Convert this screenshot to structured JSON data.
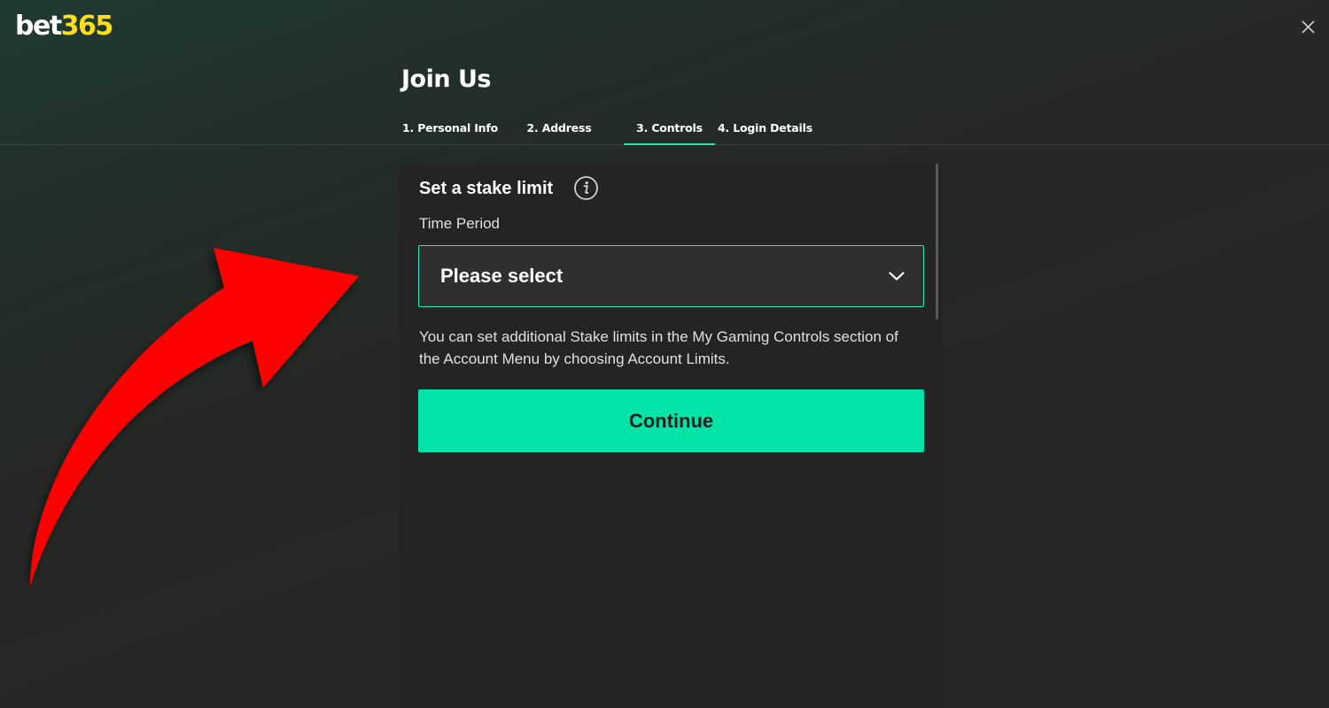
{
  "brand": {
    "logo_part_a": "bet",
    "logo_part_b": "365",
    "accent_color": "#26e8b1",
    "logo_yellow": "#ffdf1b"
  },
  "header": {
    "title": "Join Us",
    "close_icon": "close-icon"
  },
  "tabs": [
    {
      "label": "1. Personal Info",
      "active": false
    },
    {
      "label": "2. Address",
      "active": false
    },
    {
      "label": "3. Controls",
      "active": true
    },
    {
      "label": "4. Login Details",
      "active": false
    }
  ],
  "form": {
    "section_title": "Set a stake limit",
    "info_icon": "info-icon",
    "time_period": {
      "label": "Time Period",
      "selected": "Please select",
      "icon": "chevron-down-icon"
    },
    "help_text": "You can set additional Stake limits in the My Gaming Controls section of the Account Menu by choosing Account Limits.",
    "continue_label": "Continue",
    "continue_color": "#00e4a8"
  },
  "annotation": {
    "arrow_color": "#ff0000",
    "icon": "red-arrow-icon"
  }
}
